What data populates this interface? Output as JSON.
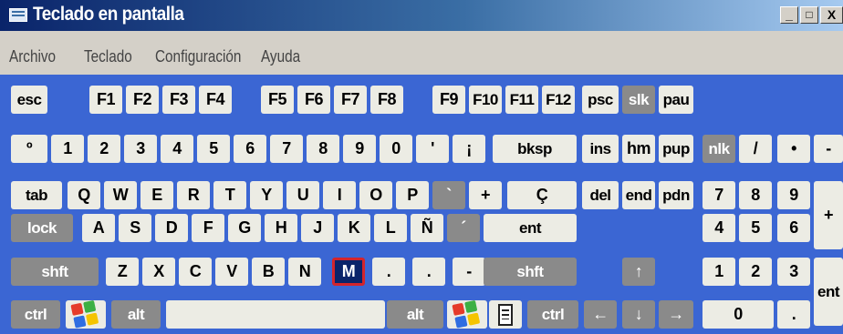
{
  "window": {
    "title": "Teclado en pantalla",
    "buttons": [
      "_",
      "□",
      "X"
    ]
  },
  "menu": [
    "Archivo",
    "Teclado",
    "Configuración",
    "Ayuda"
  ],
  "colors": {
    "keyboard_bg": "#3b66d3",
    "key": "#ecece4",
    "key_dark": "#8a8a8a",
    "selected_key": "#0a246a",
    "selected_border": "#d3242b"
  },
  "selected_key": "M",
  "keys": {
    "row1": [
      "esc",
      "F1",
      "F2",
      "F3",
      "F4",
      "F5",
      "F6",
      "F7",
      "F8",
      "F9",
      "F10",
      "F11",
      "F12",
      "psc",
      "slk",
      "pau"
    ],
    "row2": [
      "º",
      "1",
      "2",
      "3",
      "4",
      "5",
      "6",
      "7",
      "8",
      "9",
      "0",
      "'",
      "¡",
      "bksp",
      "ins",
      "hm",
      "pup",
      "nlk",
      "/",
      "•",
      "-"
    ],
    "row3": [
      "tab",
      "Q",
      "W",
      "E",
      "R",
      "T",
      "Y",
      "U",
      "I",
      "O",
      "P",
      "`",
      "+",
      "Ç",
      "del",
      "end",
      "pdn",
      "7",
      "8",
      "9",
      "+"
    ],
    "row4": [
      "lock",
      "A",
      "S",
      "D",
      "F",
      "G",
      "H",
      "J",
      "K",
      "L",
      "Ñ",
      "´",
      "ent",
      "4",
      "5",
      "6"
    ],
    "row5": [
      "shft",
      "Z",
      "X",
      "C",
      "V",
      "B",
      "N",
      "M",
      ".",
      ".",
      "-",
      "shft",
      "↑",
      "1",
      "2",
      "3",
      "ent"
    ],
    "row6": [
      "ctrl",
      "windows-logo-icon",
      "alt",
      "",
      "alt",
      "windows-logo-icon",
      "menu-key-icon",
      "ctrl",
      "←",
      "↓",
      "→",
      "0",
      "."
    ]
  }
}
